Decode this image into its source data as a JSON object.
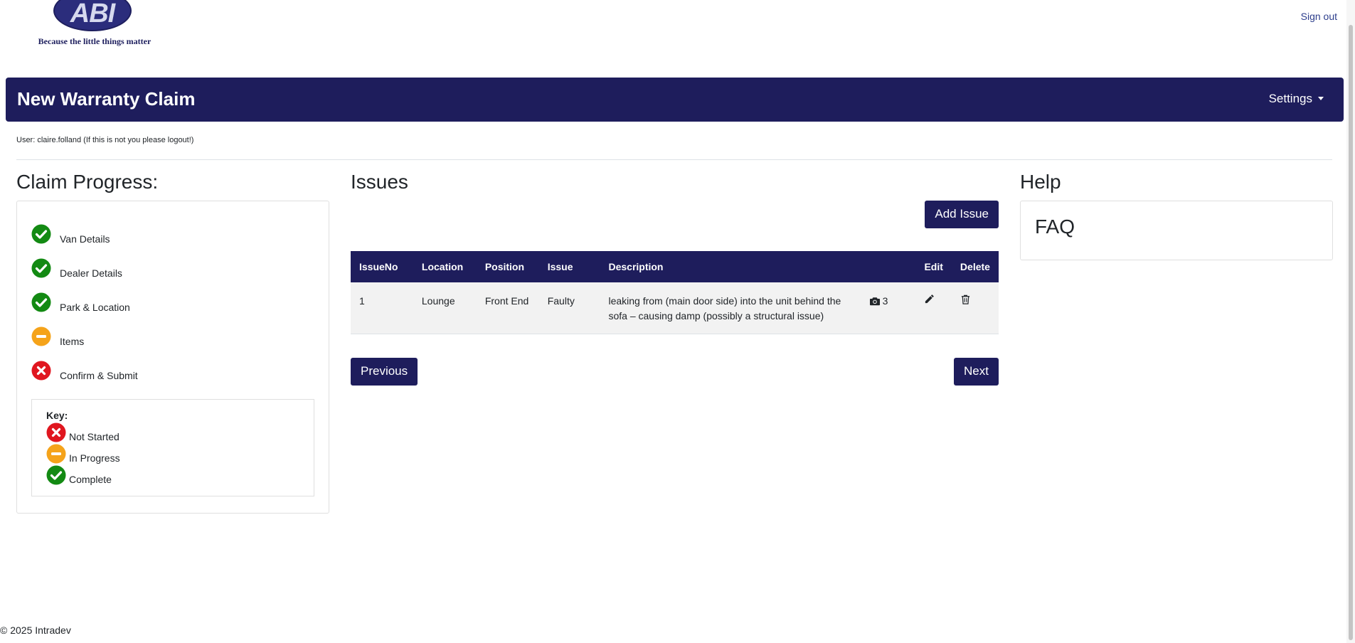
{
  "header": {
    "logo_text": "ABI",
    "tagline": "Because the little things matter",
    "sign_out": "Sign out"
  },
  "navbar": {
    "title": "New Warranty Claim",
    "settings": "Settings"
  },
  "user_line": "User: claire.folland (If this is not you please logout!)",
  "progress": {
    "heading": "Claim Progress:",
    "steps": [
      {
        "label": "Van Details",
        "status": "complete"
      },
      {
        "label": "Dealer Details",
        "status": "complete"
      },
      {
        "label": "Park & Location",
        "status": "complete"
      },
      {
        "label": "Items",
        "status": "in-progress"
      },
      {
        "label": "Confirm & Submit",
        "status": "not-started"
      }
    ],
    "key": {
      "title": "Key:",
      "items": [
        {
          "label": "Not Started",
          "status": "not-started"
        },
        {
          "label": "In Progress",
          "status": "in-progress"
        },
        {
          "label": "Complete",
          "status": "complete"
        }
      ]
    }
  },
  "issues": {
    "heading": "Issues",
    "add_button": "Add Issue",
    "columns": [
      "IssueNo",
      "Location",
      "Position",
      "Issue",
      "Description",
      "",
      "Edit",
      "Delete"
    ],
    "rows": [
      {
        "issue_no": "1",
        "location": "Lounge",
        "position": "Front End",
        "issue": "Faulty",
        "description": "leaking from (main door side) into the unit behind the sofa – causing damp (possibly a structural issue)",
        "photo_count": "3"
      }
    ],
    "previous_button": "Previous",
    "next_button": "Next"
  },
  "help": {
    "heading": "Help",
    "faq": "FAQ"
  },
  "footer": "© 2025 Intradev",
  "colors": {
    "brand": "#1e1d5c",
    "complete": "#138a13",
    "in_progress": "#f5a31a",
    "not_started": "#e0161f"
  },
  "icons": {
    "complete": "check-circle-icon",
    "in_progress": "minus-circle-icon",
    "not_started": "x-circle-icon",
    "photo": "camera-icon",
    "edit": "pencil-icon",
    "delete": "trash-icon"
  }
}
